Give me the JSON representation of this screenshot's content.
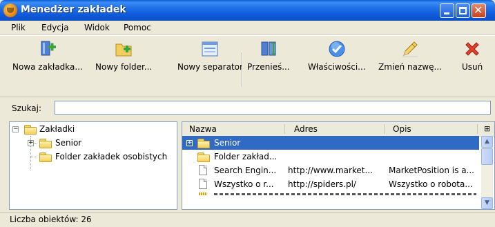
{
  "window": {
    "title": "Menedżer zakładek"
  },
  "menu": [
    "Plik",
    "Edycja",
    "Widok",
    "Pomoc"
  ],
  "toolbar": {
    "new_bookmark": "Nowa zakładka...",
    "new_folder": "Nowy folder...",
    "new_separator": "Nowy separator",
    "move": "Przenieś...",
    "properties": "Właściwości...",
    "rename": "Zmień nazwę...",
    "delete": "Usuń"
  },
  "search": {
    "label": "Szukaj:",
    "value": ""
  },
  "tree": {
    "root": "Zakładki",
    "children": [
      "Senior",
      "Folder zakładek osobistych"
    ]
  },
  "list": {
    "columns": [
      "Nazwa",
      "Adres",
      "Opis"
    ],
    "rows": [
      {
        "name": "Senior",
        "address": "",
        "description": "",
        "type": "folder",
        "selected": true
      },
      {
        "name": "Folder zakład...",
        "address": "",
        "description": "",
        "type": "folder",
        "selected": false
      },
      {
        "name": "Search Engin...",
        "address": "http://www.market...",
        "description": "MarketPosition is a...",
        "type": "page",
        "selected": false
      },
      {
        "name": "Wszystko o r...",
        "address": "http://spiders.pl/",
        "description": "Wszystko o robota...",
        "type": "page",
        "selected": false
      }
    ]
  },
  "status": {
    "text": "Liczba obiektów: 26"
  },
  "colors": {
    "title_bar": "#0c5bdc",
    "selection": "#316ac5",
    "face": "#ece9d8"
  }
}
